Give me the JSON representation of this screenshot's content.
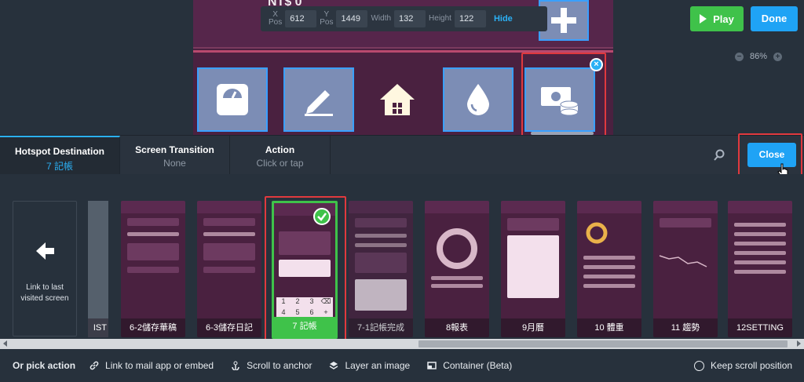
{
  "toolbar": {
    "x_label": "X\nPos",
    "x_value": "612",
    "y_label": "Y\nPos",
    "y_value": "1449",
    "width_label": "Width",
    "width_value": "132",
    "height_label": "Height",
    "height_value": "122",
    "hide_label": "Hide"
  },
  "header": {
    "play_label": "Play",
    "done_label": "Done",
    "zoom": "86%"
  },
  "artboard": {
    "peek_text": "NT$ 0"
  },
  "tabs": [
    {
      "title": "Hotspot Destination",
      "sub": "7 記帳"
    },
    {
      "title": "Screen Transition",
      "sub": "None"
    },
    {
      "title": "Action",
      "sub": "Click or tap"
    }
  ],
  "close_label": "Close",
  "link_last": "Link to last visited screen",
  "partial_label": "IST",
  "screens": [
    {
      "label": "6-2儲存華稿"
    },
    {
      "label": "6-3儲存日記"
    },
    {
      "label": "7 記帳",
      "selected": true
    },
    {
      "label": "7-1記帳完成"
    },
    {
      "label": "8報表"
    },
    {
      "label": "9月曆"
    },
    {
      "label": "10 體重"
    },
    {
      "label": "11 趨勢"
    },
    {
      "label": "12SETTING"
    }
  ],
  "bottom": {
    "or_pick": "Or pick action",
    "mail": "Link to mail app or embed",
    "scroll": "Scroll to anchor",
    "layer": "Layer an image",
    "container": "Container (Beta)",
    "keep_scroll": "Keep scroll position"
  },
  "colors": {
    "accent": "#2bb0f5",
    "play": "#3fc24a",
    "highlight": "#e0393e",
    "artboard": "#4a2140"
  }
}
